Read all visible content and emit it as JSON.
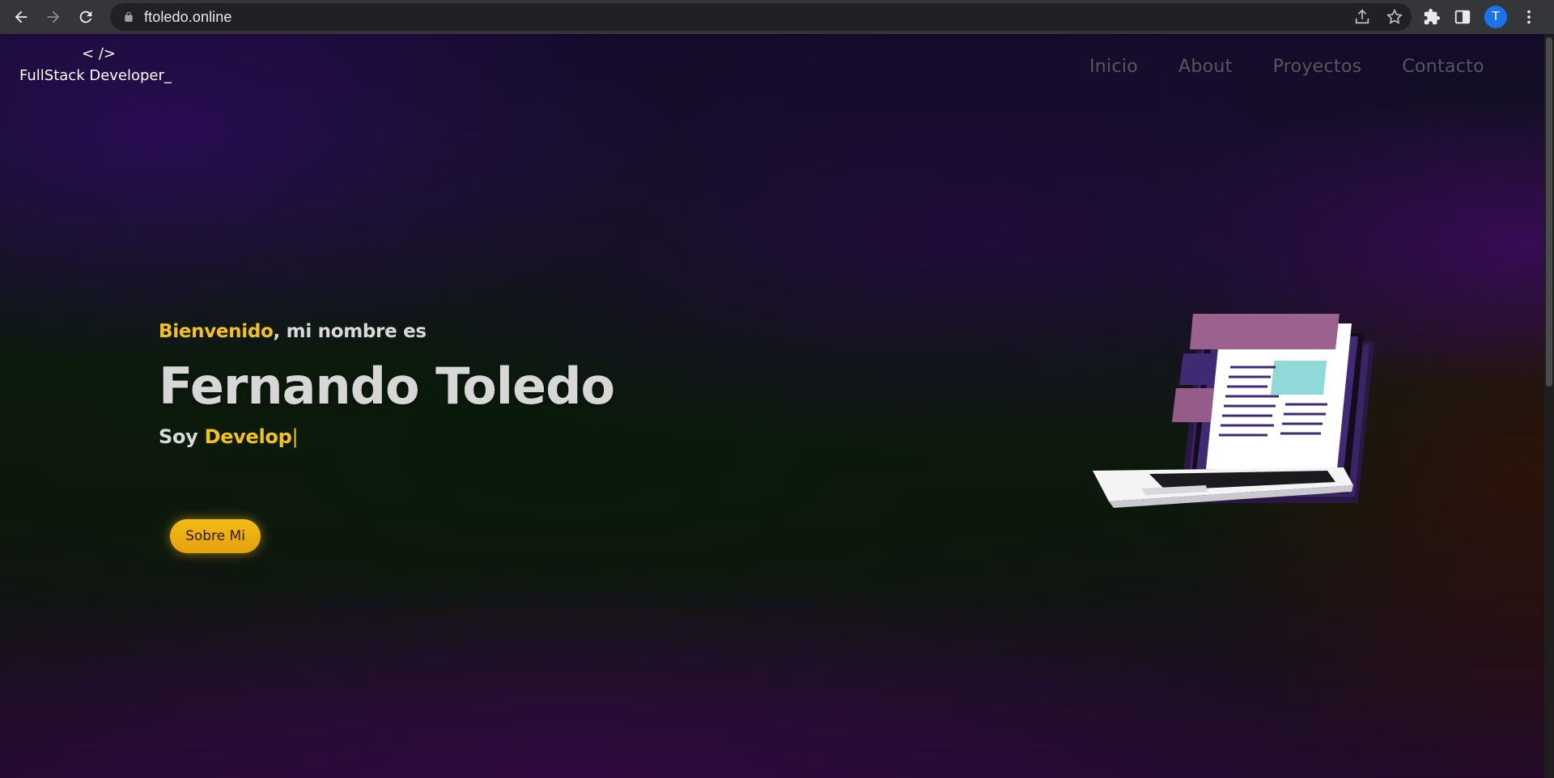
{
  "browser": {
    "url": "ftoledo.online",
    "avatar_letter": "T"
  },
  "site": {
    "logo_mark": "< />",
    "logo_text": "FullStack Developer_",
    "nav": [
      "Inicio",
      "About",
      "Proyectos",
      "Contacto"
    ]
  },
  "hero": {
    "greeting_highlight": "Bienvenido",
    "greeting_rest": ", mi nombre es",
    "name": "Fernando Toledo",
    "role_prefix": "Soy ",
    "role_typed": "Develop",
    "caret": "|",
    "button_label": "Sobre Mi"
  },
  "colors": {
    "accent": "#f3c21b",
    "text": "#d7d7d7",
    "nav_text": "#55575e"
  }
}
